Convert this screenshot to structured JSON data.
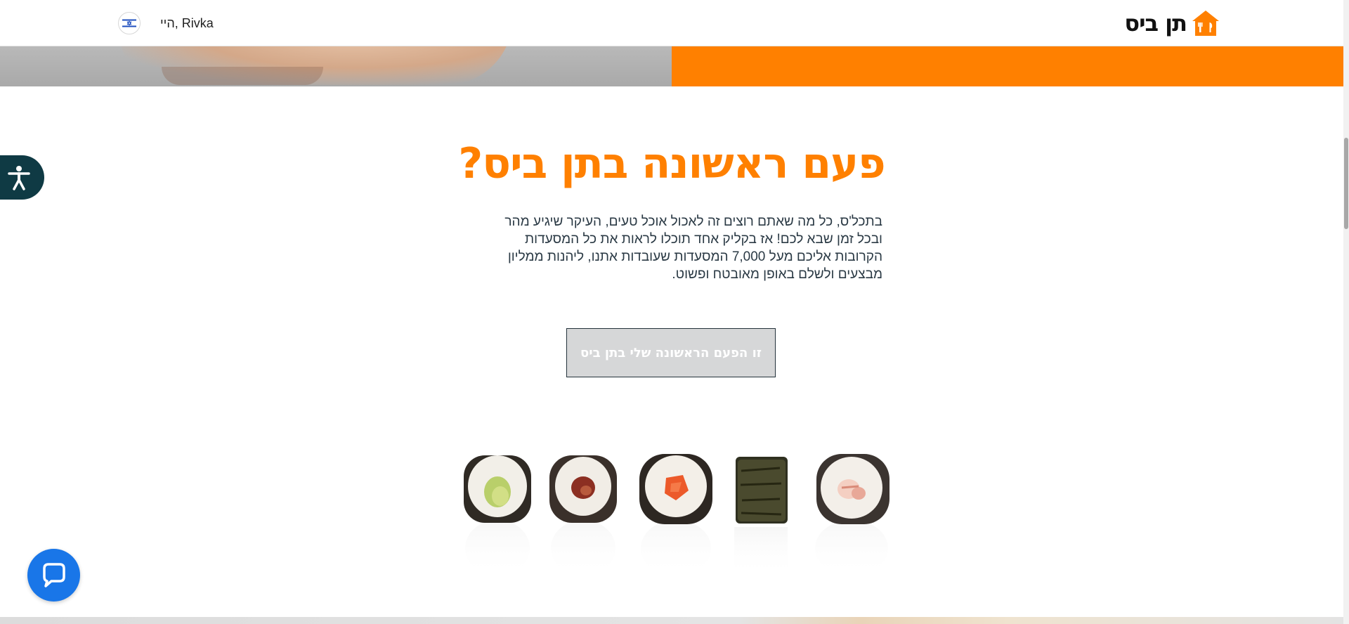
{
  "header": {
    "logo_text": "תן ביס",
    "greeting": "היי, Rivka",
    "flag_icon": "israel-flag-icon"
  },
  "colors": {
    "brand_orange": "#ff8000",
    "dark_teal": "#0f3a44",
    "chat_blue": "#1976e8",
    "cta_bg": "#d6d7d8"
  },
  "main": {
    "headline": "פעם ראשונה בתן ביס?",
    "body": "בתכל'ס, כל מה שאתם רוצים זה לאכול אוכל טעים, העיקר שיגיע מהר ובכל זמן שבא לכם! אז בקליק אחד תוכלו לראות את כל המסעדות הקרובות אליכם מעל 7,000 המסעדות שעובדות אתנו, ליהנות ממליון מבצעים ולשלם באופן מאובטח ופשוט.",
    "cta_label": "זו הפעם הראשונה שלי בתן ביס"
  },
  "widgets": {
    "accessibility_icon": "accessibility-icon",
    "chat_icon": "chat-bubble-icon"
  }
}
